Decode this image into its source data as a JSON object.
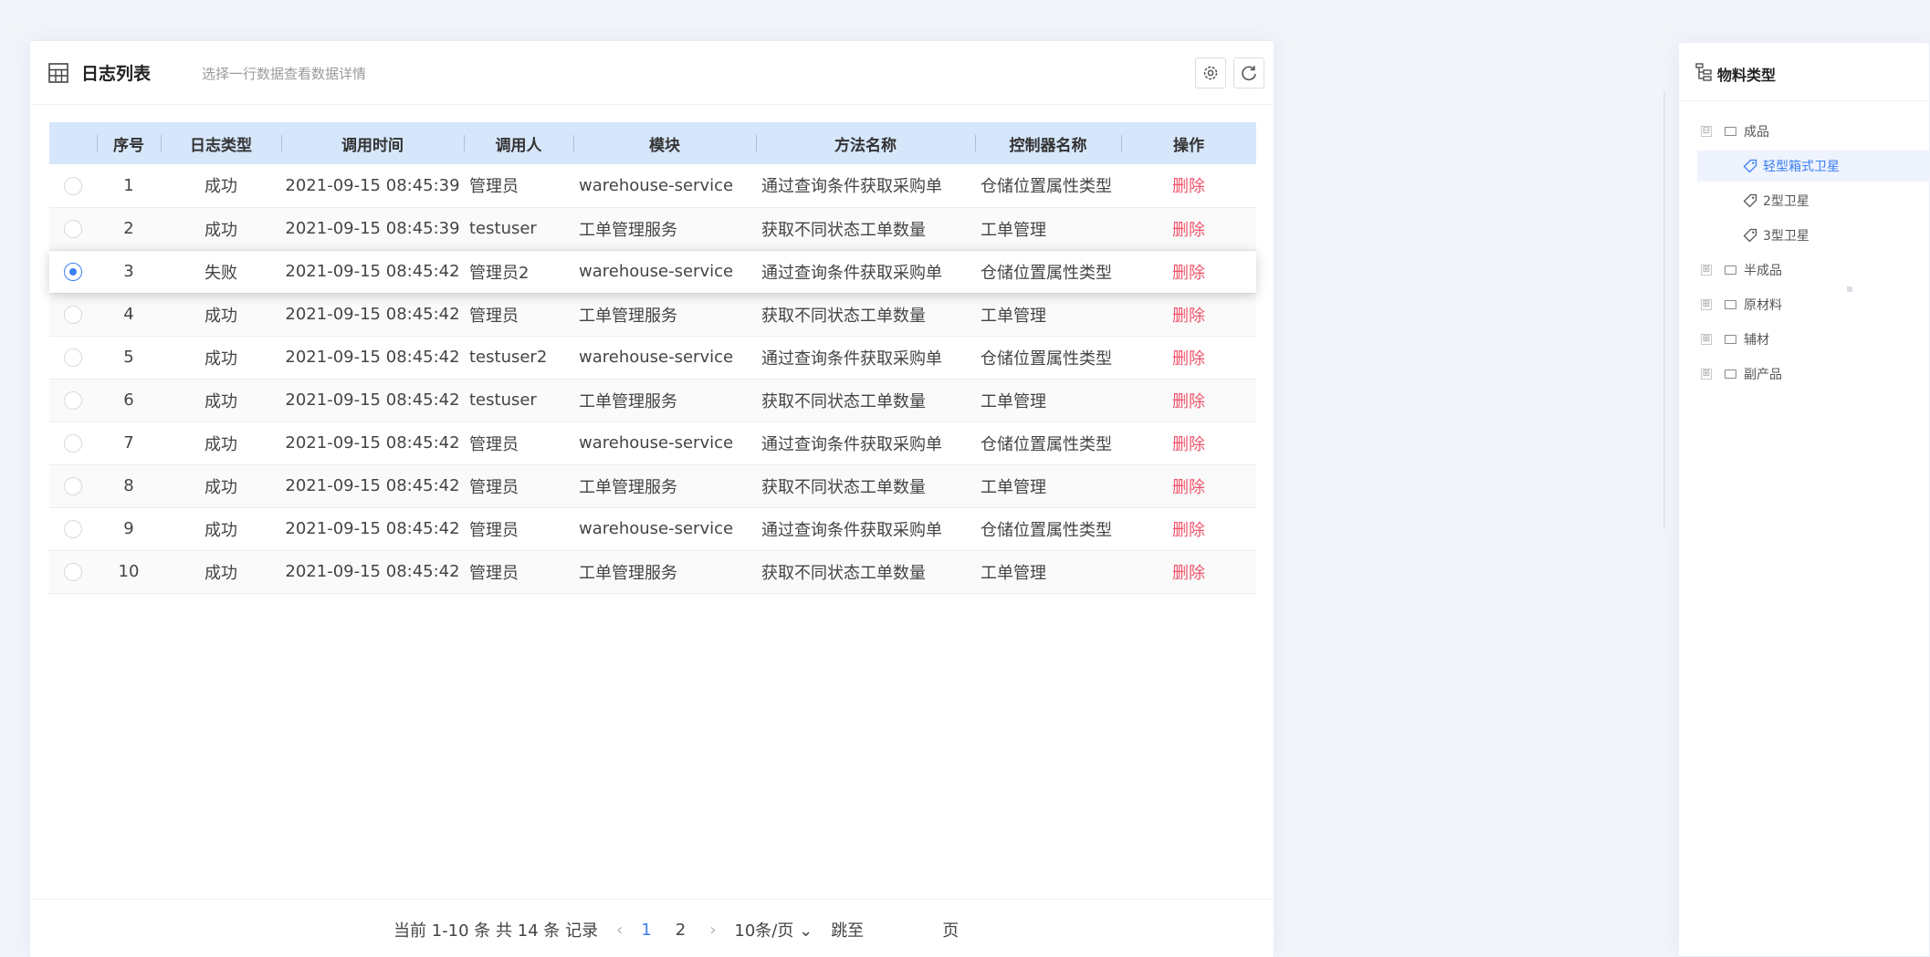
{
  "log_panel": {
    "title": "日志列表",
    "subtitle": "选择一行数据查看数据详情",
    "columns": [
      "",
      "序号",
      "日志类型",
      "调用时间",
      "调用人",
      "模块",
      "方法名称",
      "控制器名称",
      "操作"
    ],
    "rows": [
      {
        "no": "1",
        "type": "成功",
        "time": "2021-09-15 08:45:39",
        "user": "管理员",
        "module": "warehouse-service",
        "method": "通过查询条件获取采购单",
        "controller": "仓储位置属性类型",
        "action": "删除",
        "selected": false
      },
      {
        "no": "2",
        "type": "成功",
        "time": "2021-09-15 08:45:39",
        "user": "testuser",
        "module": "工单管理服务",
        "method": "获取不同状态工单数量",
        "controller": "工单管理",
        "action": "删除",
        "selected": false
      },
      {
        "no": "3",
        "type": "失败",
        "time": "2021-09-15 08:45:42",
        "user": "管理员2",
        "module": "warehouse-service",
        "method": "通过查询条件获取采购单",
        "controller": "仓储位置属性类型",
        "action": "删除",
        "selected": true
      },
      {
        "no": "4",
        "type": "成功",
        "time": "2021-09-15 08:45:42",
        "user": "管理员",
        "module": "工单管理服务",
        "method": "获取不同状态工单数量",
        "controller": "工单管理",
        "action": "删除",
        "selected": false
      },
      {
        "no": "5",
        "type": "成功",
        "time": "2021-09-15 08:45:42",
        "user": "testuser2",
        "module": "warehouse-service",
        "method": "通过查询条件获取采购单",
        "controller": "仓储位置属性类型",
        "action": "删除",
        "selected": false
      },
      {
        "no": "6",
        "type": "成功",
        "time": "2021-09-15 08:45:42",
        "user": "testuser",
        "module": "工单管理服务",
        "method": "获取不同状态工单数量",
        "controller": "工单管理",
        "action": "删除",
        "selected": false
      },
      {
        "no": "7",
        "type": "成功",
        "time": "2021-09-15 08:45:42",
        "user": "管理员",
        "module": "warehouse-service",
        "method": "通过查询条件获取采购单",
        "controller": "仓储位置属性类型",
        "action": "删除",
        "selected": false
      },
      {
        "no": "8",
        "type": "成功",
        "time": "2021-09-15 08:45:42",
        "user": "管理员",
        "module": "工单管理服务",
        "method": "获取不同状态工单数量",
        "controller": "工单管理",
        "action": "删除",
        "selected": false
      },
      {
        "no": "9",
        "type": "成功",
        "time": "2021-09-15 08:45:42",
        "user": "管理员",
        "module": "warehouse-service",
        "method": "通过查询条件获取采购单",
        "controller": "仓储位置属性类型",
        "action": "删除",
        "selected": false
      },
      {
        "no": "10",
        "type": "成功",
        "time": "2021-09-15 08:45:42",
        "user": "管理员",
        "module": "工单管理服务",
        "method": "获取不同状态工单数量",
        "controller": "工单管理",
        "action": "删除",
        "selected": false
      }
    ],
    "pagination": {
      "summary": "当前 1-10 条 共 14 条 记录",
      "prev": "‹",
      "pages": [
        "1",
        "2"
      ],
      "active_page": "1",
      "next": "›",
      "page_size": "10条/页 ⌄",
      "jump_label": "跳至",
      "jump_suffix": "页"
    }
  },
  "material_panel": {
    "title": "物料类型",
    "tree": [
      {
        "label": "成品",
        "level": 0,
        "kind": "folder",
        "expander": "⊟"
      },
      {
        "label": "轻型箱式卫星",
        "level": 1,
        "kind": "tag",
        "selected": true
      },
      {
        "label": "2型卫星",
        "level": 1,
        "kind": "tag"
      },
      {
        "label": "3型卫星",
        "level": 1,
        "kind": "tag"
      },
      {
        "label": "半成品",
        "level": 0,
        "kind": "folder",
        "expander": "⊞"
      },
      {
        "label": "原材料",
        "level": 0,
        "kind": "folder",
        "expander": "⊞"
      },
      {
        "label": "辅材",
        "level": 0,
        "kind": "folder",
        "expander": "⊞"
      },
      {
        "label": "副产品",
        "level": 0,
        "kind": "folder",
        "expander": "⊞"
      }
    ]
  },
  "colors": {
    "accent": "#3c7ff2",
    "danger": "#f0546a",
    "header_bg": "#d6e6fb"
  },
  "icons": [
    "table-icon",
    "settings-icon",
    "refresh-icon",
    "tree-icon",
    "tag-icon",
    "folder-icon"
  ]
}
